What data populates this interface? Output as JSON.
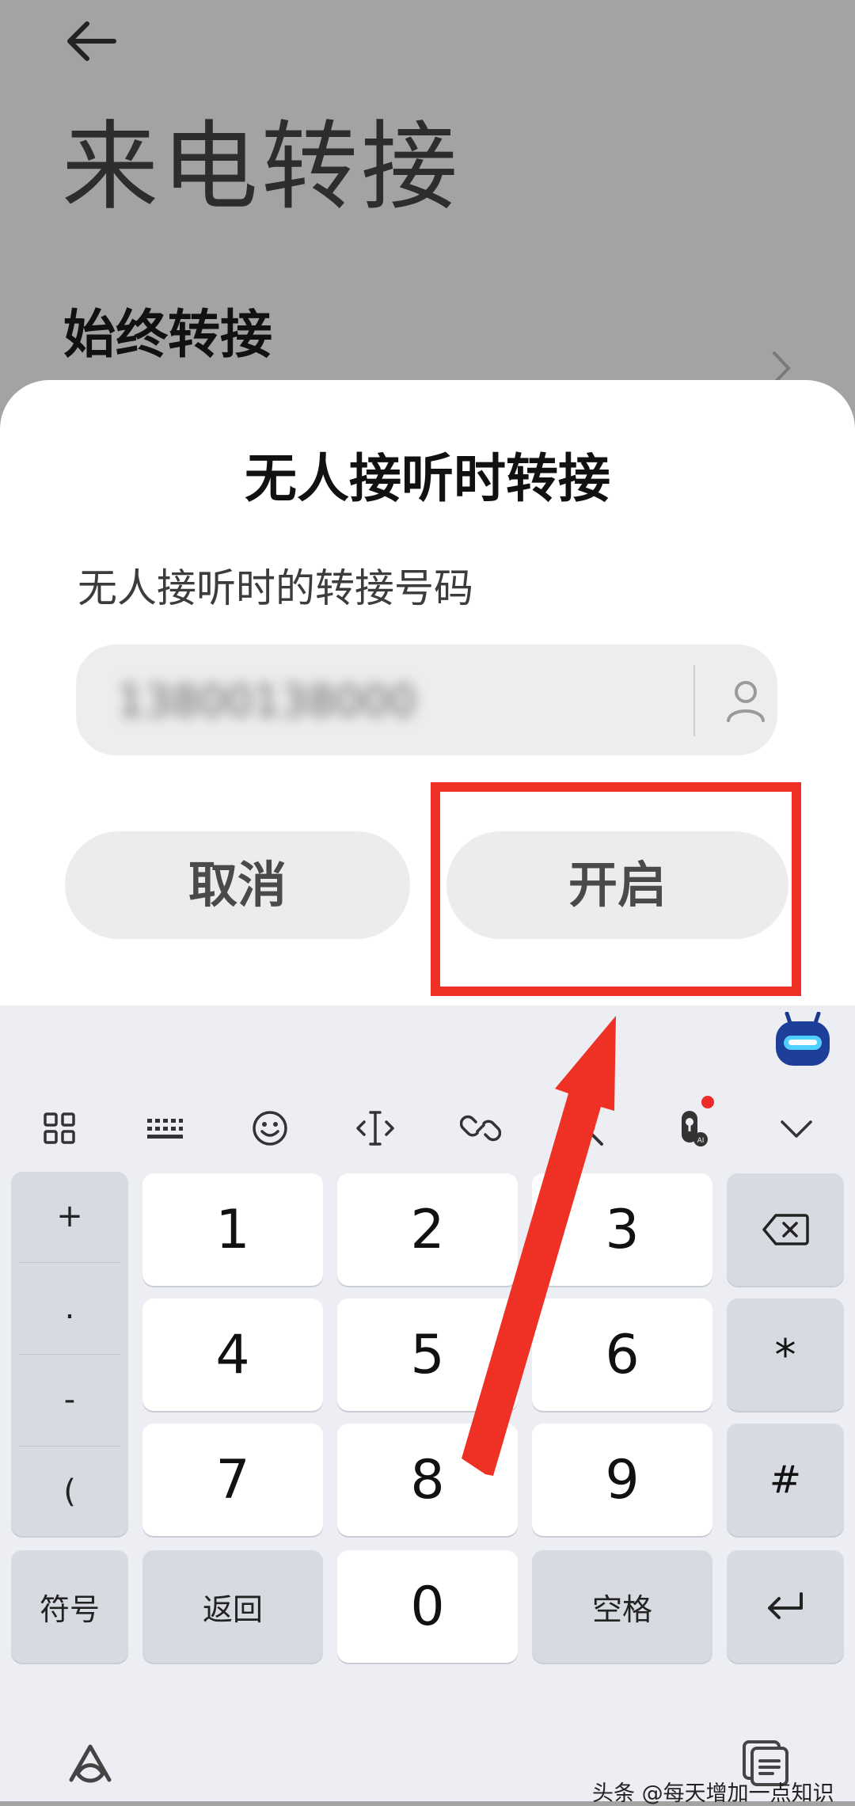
{
  "header": {
    "back_icon": "arrow-left-icon",
    "title": "来电转接"
  },
  "settings": {
    "item_title": "始终转接",
    "chevron_icon": "chevron-right-icon"
  },
  "dialog": {
    "title": "无人接听时转接",
    "field_label": "无人接听时的转接号码",
    "field_value": "13800138000",
    "contact_icon": "person-icon",
    "cancel_label": "取消",
    "enable_label": "开启"
  },
  "annotation": {
    "color": "#ee3124"
  },
  "keyboard": {
    "toolbar_icons": [
      "grid-icon",
      "keyboard-icon",
      "emoji-icon",
      "cursor-icon",
      "link-icon",
      "search-icon",
      "mic-icon",
      "collapse-icon"
    ],
    "symbols": [
      "+",
      ".",
      "-",
      "("
    ],
    "digits": [
      "1",
      "2",
      "3",
      "4",
      "5",
      "6",
      "7",
      "8",
      "9",
      "0"
    ],
    "side_keys": [
      "*",
      "#"
    ],
    "symbols_label": "符号",
    "return_label": "返回",
    "space_label": "空格"
  },
  "watermark": "头条 @每天增加一点知识"
}
